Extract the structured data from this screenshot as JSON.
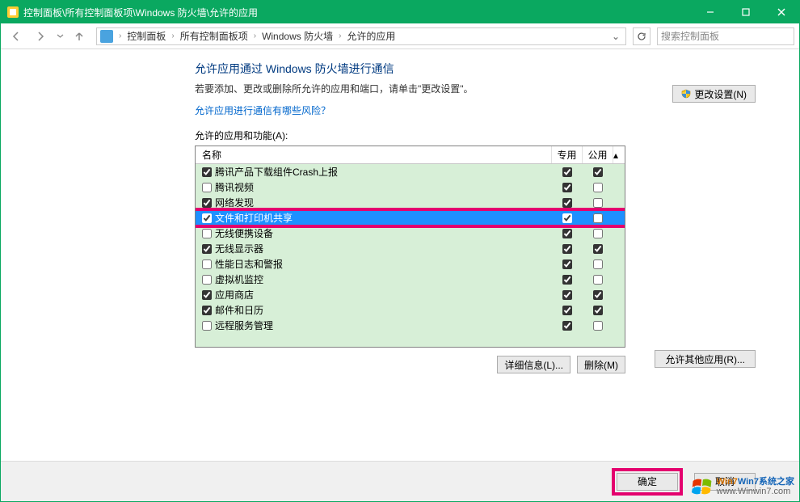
{
  "titlebar": {
    "title": "控制面板\\所有控制面板项\\Windows 防火墙\\允许的应用"
  },
  "breadcrumbs": {
    "items": [
      "控制面板",
      "所有控制面板项",
      "Windows 防火墙",
      "允许的应用"
    ]
  },
  "search": {
    "placeholder": "搜索控制面板"
  },
  "page": {
    "heading": "允许应用通过 Windows 防火墙进行通信",
    "desc": "若要添加、更改或删除所允许的应用和端口，请单击\"更改设置\"。",
    "risk_link": "允许应用进行通信有哪些风险？",
    "change_settings": "更改设置(N)",
    "list_label": "允许的应用和功能(A):",
    "cols": {
      "name": "名称",
      "private": "专用",
      "public": "公用"
    },
    "details": "详细信息(L)...",
    "remove": "删除(M)",
    "allow_other": "允许其他应用(R)..."
  },
  "rows": [
    {
      "name": "腾讯产品下载组件Crash上报",
      "enabled": true,
      "private": true,
      "public": true
    },
    {
      "name": "腾讯视频",
      "enabled": false,
      "private": true,
      "public": false
    },
    {
      "name": "网络发现",
      "enabled": true,
      "private": true,
      "public": false
    },
    {
      "name": "文件和打印机共享",
      "enabled": true,
      "private": true,
      "public": false,
      "selected": true
    },
    {
      "name": "无线便携设备",
      "enabled": false,
      "private": true,
      "public": false
    },
    {
      "name": "无线显示器",
      "enabled": true,
      "private": true,
      "public": true
    },
    {
      "name": "性能日志和警报",
      "enabled": false,
      "private": true,
      "public": false
    },
    {
      "name": "虚拟机监控",
      "enabled": false,
      "private": true,
      "public": false
    },
    {
      "name": "应用商店",
      "enabled": true,
      "private": true,
      "public": true
    },
    {
      "name": "邮件和日历",
      "enabled": true,
      "private": true,
      "public": true
    },
    {
      "name": "远程服务管理",
      "enabled": false,
      "private": true,
      "public": false
    }
  ],
  "footer": {
    "ok": "确定",
    "cancel": "取消"
  },
  "watermark": {
    "line1": "Win7系统之家",
    "line2": "www.Winwin7.com"
  }
}
